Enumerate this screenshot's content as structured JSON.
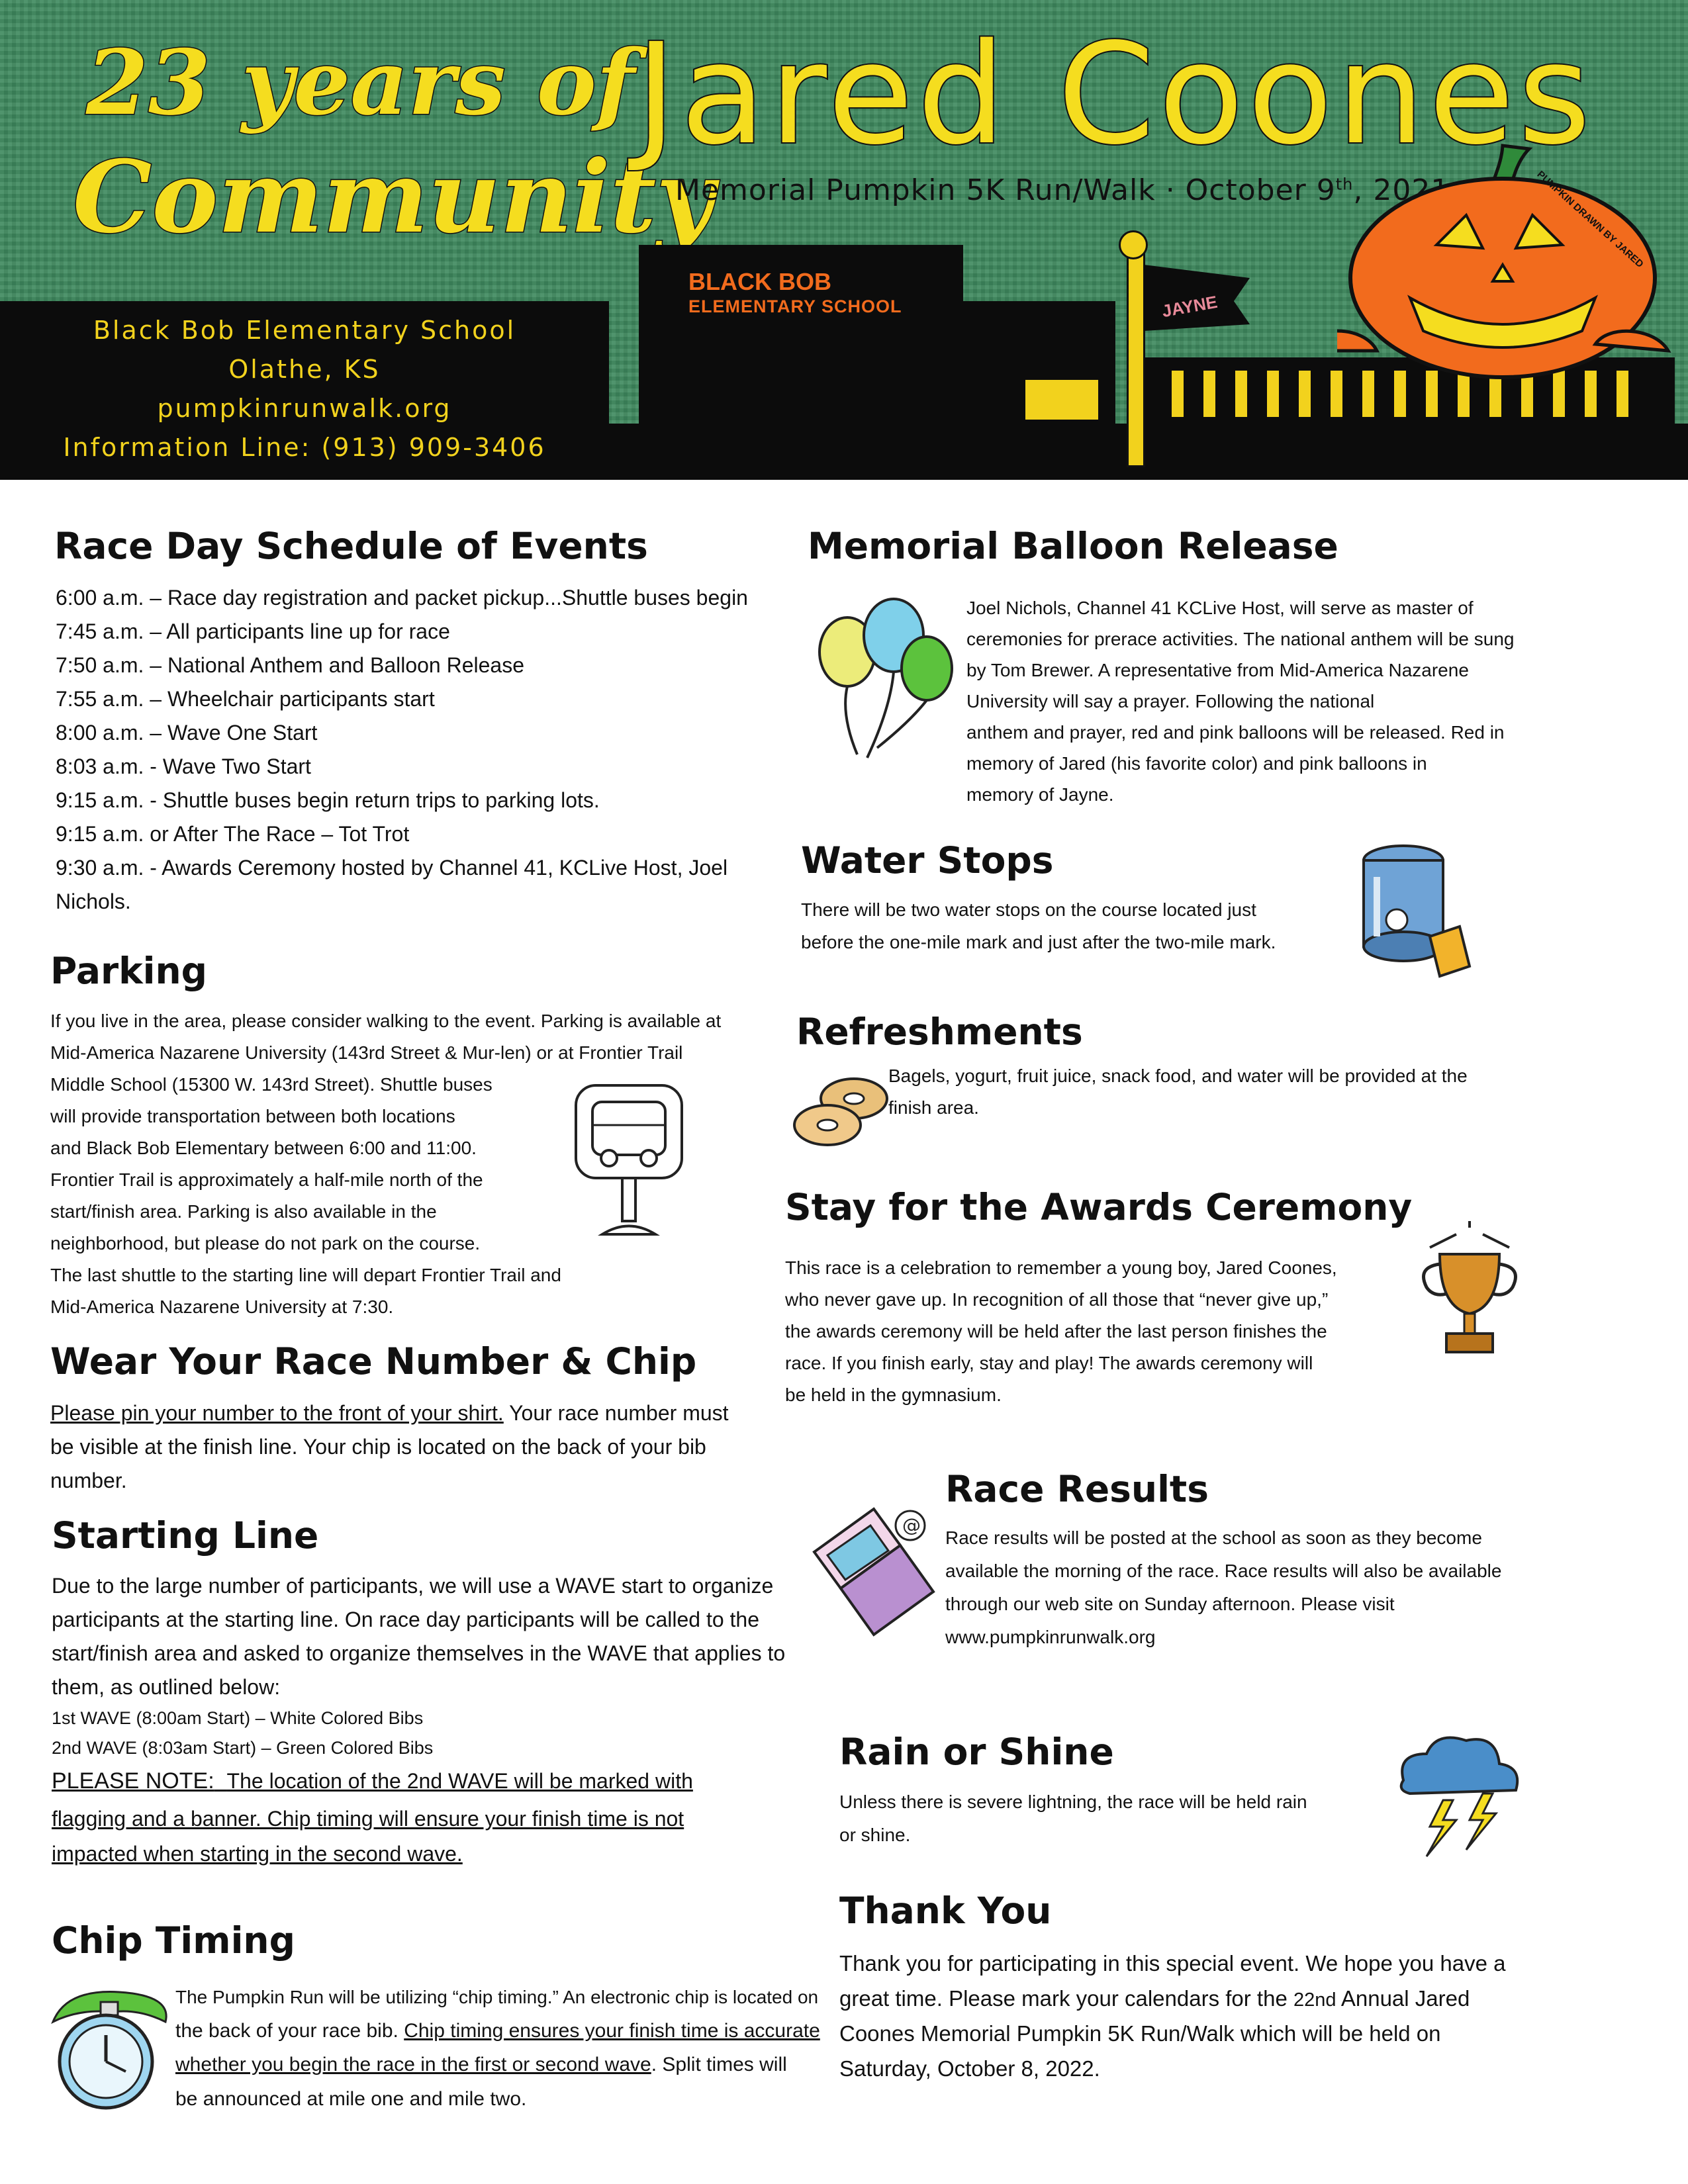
{
  "header": {
    "tagline_line1": "23 years of",
    "tagline_line2": "Community",
    "title": "Jared Coones",
    "subtitle_pre": "Memorial Pumpkin 5K Run/Walk · October 9",
    "subtitle_sup": "th",
    "subtitle_post": ", 2021",
    "info": [
      "Black Bob Elementary School",
      "Olathe, KS",
      "pumpkinrunwalk.org",
      "Information Line: (913) 909-3406"
    ],
    "school_sign": "BLACK BOB",
    "school_sign_sub": "ELEMENTARY SCHOOL",
    "flag_text": "JAYNE",
    "pumpkin_credit": "PUMPKIN DRAWN BY JARED",
    "colors": {
      "green": "#3f8a5f",
      "yellow": "#f5dd1f",
      "orange": "#f26b1d",
      "black": "#0c0c0c"
    }
  },
  "schedule": {
    "heading": "Race Day Schedule of Events",
    "items": [
      "6:00 a.m. – Race day registration and packet pickup...Shuttle buses begin",
      "7:45 a.m. – All participants line up for race",
      "7:50 a.m. – National Anthem and Balloon Release",
      "7:55 a.m. – Wheelchair participants start",
      "8:00 a.m. – Wave One Start",
      "8:03 a.m. - Wave Two Start",
      "9:15 a.m. - Shuttle buses begin return trips to parking lots.",
      "9:15 a.m. or After The Race – Tot Trot",
      "9:30 a.m.  - Awards Ceremony hosted by Channel 41, KCLive Host, Joel",
      "Nichols."
    ]
  },
  "parking": {
    "heading": "Parking",
    "lines": [
      "If you live in the area, please consider walking to the event.  Parking is available at",
      "Mid-America Nazarene University (143rd Street & Mur-len) or at Frontier Trail",
      "Middle School (15300 W. 143rd Street).  Shuttle buses",
      "will provide transportation between both locations",
      "and Black Bob Elementary between 6:00 and 11:00.",
      "Frontier Trail is approximately a half-mile north of the",
      "start/finish area.  Parking is also available in the",
      "neighborhood, but please do not park on the course.",
      "The last shuttle to the starting line will depart Frontier Trail and",
      "Mid-America Nazarene University at 7:30."
    ]
  },
  "race_number": {
    "heading": "Wear Your Race Number & Chip",
    "underlined": "Please pin your number to the front of your shirt.",
    "rest_line1": "  Your race number must",
    "lines": [
      "be visible at the finish line.  Your chip is located on the back of your bib",
      "number."
    ]
  },
  "starting_line": {
    "heading": "Starting Line",
    "lines": [
      "Due to the large number of participants, we will use a WAVE start to organize",
      "participants at the starting line.  On race day participants will be called to the",
      "start/finish area and asked to organize themselves in the WAVE that  applies to",
      "them, as outlined below:"
    ],
    "waves": [
      "1st WAVE (8:00am Start) – White Colored Bibs",
      "2nd WAVE (8:03am Start) – Green Colored Bibs"
    ],
    "note_label": "PLEASE NOTE:",
    "note_lines": [
      "The location of the 2nd WAVE will be marked with",
      "flagging and a banner.  Chip timing will ensure your finish time is not",
      "impacted when starting in the second wave."
    ]
  },
  "chip_timing": {
    "heading": "Chip Timing",
    "line1": "The Pumpkin Run will be utilizing “chip timing.”  An electronic chip is located on",
    "line2_plain": "the back of your race bib.  ",
    "line2_underlined": "Chip timing ensures your finish time is accurate",
    "line3_underlined": "whether you begin the race in the first or second wave",
    "line3_plain": ".  Split times will",
    "line4": "be announced at mile one and mile two."
  },
  "balloon": {
    "heading": "Memorial Balloon Release",
    "lines": [
      "Joel Nichols, Channel 41 KCLive Host, will serve as master of",
      "ceremonies for prerace activities.  The national anthem will be sung",
      "by Tom Brewer. A representative from Mid-America Nazarene",
      "University will say a prayer.   Following the national",
      "anthem and prayer, red and pink balloons will be released.  Red in",
      "memory of Jared (his favorite color) and pink balloons in",
      "memory of Jayne."
    ]
  },
  "water": {
    "heading": "Water Stops",
    "lines": [
      "There will be two water stops on the course located just",
      "before the one-mile mark and just after the two-mile mark."
    ]
  },
  "refreshments": {
    "heading": "Refreshments",
    "lines": [
      "Bagels, yogurt, fruit juice, snack food, and water will be provided at the",
      "finish area."
    ]
  },
  "awards": {
    "heading": "Stay for the Awards Ceremony",
    "lines": [
      "This race is a celebration to remember a young boy, Jared Coones,",
      "who never gave up.  In recognition of all those that “never give up,”",
      "the awards ceremony will be held after the last person finishes the",
      "race.  If you finish early, stay and play!  The awards ceremony will",
      "be held in the gymnasium."
    ]
  },
  "results": {
    "heading": "Race Results",
    "lines": [
      "Race results will be posted at the school as soon as they become",
      "available the morning of the race.  Race results will also be available",
      "through our web site on Sunday afternoon.  Please visit",
      "www.pumpkinrunwalk.org"
    ]
  },
  "rain": {
    "heading": "Rain or Shine",
    "lines": [
      "Unless there is severe lightning, the race will be held rain",
      "or shine."
    ]
  },
  "thanks": {
    "heading": "Thank You",
    "line1": "Thank you for participating in this special event.  We hope you have a",
    "line2_pre": "great time.  Please mark your calendars for the ",
    "line2_small": "22nd",
    "line2_post": " Annual Jared",
    "line3": "Coones Memorial Pumpkin 5K Run/Walk which will be held on",
    "line4": "Saturday, October  8, 2022."
  }
}
